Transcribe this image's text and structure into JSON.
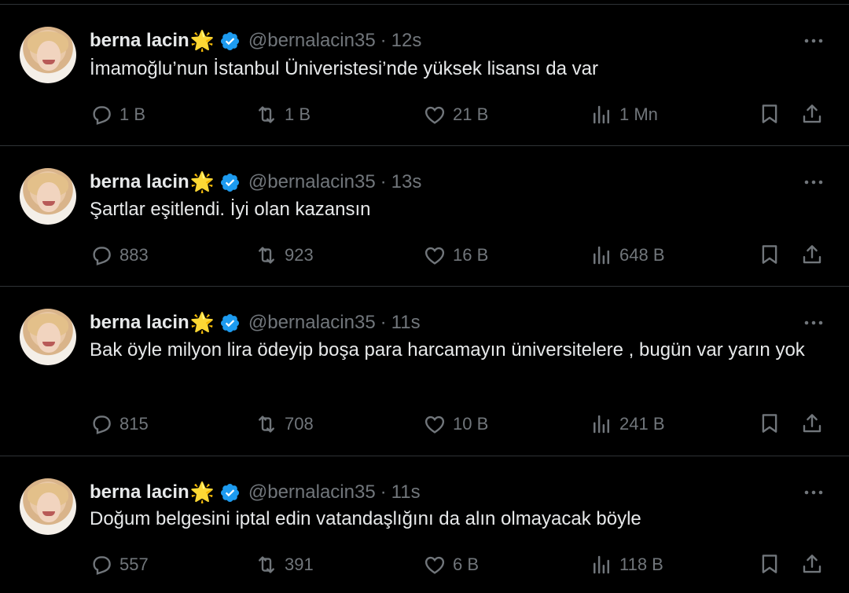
{
  "author": {
    "name": "berna lacin",
    "emoji": "🌟",
    "handle": "@bernalacin35",
    "verified_color": "#1d9bf0"
  },
  "colors": {
    "background": "#000000",
    "text": "#e7e9ea",
    "muted": "#71767b",
    "divider": "#2f3336"
  },
  "tweets": [
    {
      "time": "12s",
      "text": "İmamoğlu’nun İstanbul Üniveristesi’nde yüksek lisansı da var",
      "replies": "1 B",
      "retweets": "1 B",
      "likes": "21 B",
      "views": "1 Mn"
    },
    {
      "time": "13s",
      "text": "Şartlar eşitlendi. İyi olan kazansın",
      "replies": "883",
      "retweets": "923",
      "likes": "16 B",
      "views": "648 B"
    },
    {
      "time": "11s",
      "text": "Bak öyle milyon lira ödeyip boşa para harcamayın üniversitelere , bugün var yarın yok",
      "replies": "815",
      "retweets": "708",
      "likes": "10 B",
      "views": "241 B"
    },
    {
      "time": "11s",
      "text": "Doğum belgesini iptal edin vatandaşlığını da alın olmayacak böyle",
      "replies": "557",
      "retweets": "391",
      "likes": "6 B",
      "views": "118 B"
    }
  ]
}
